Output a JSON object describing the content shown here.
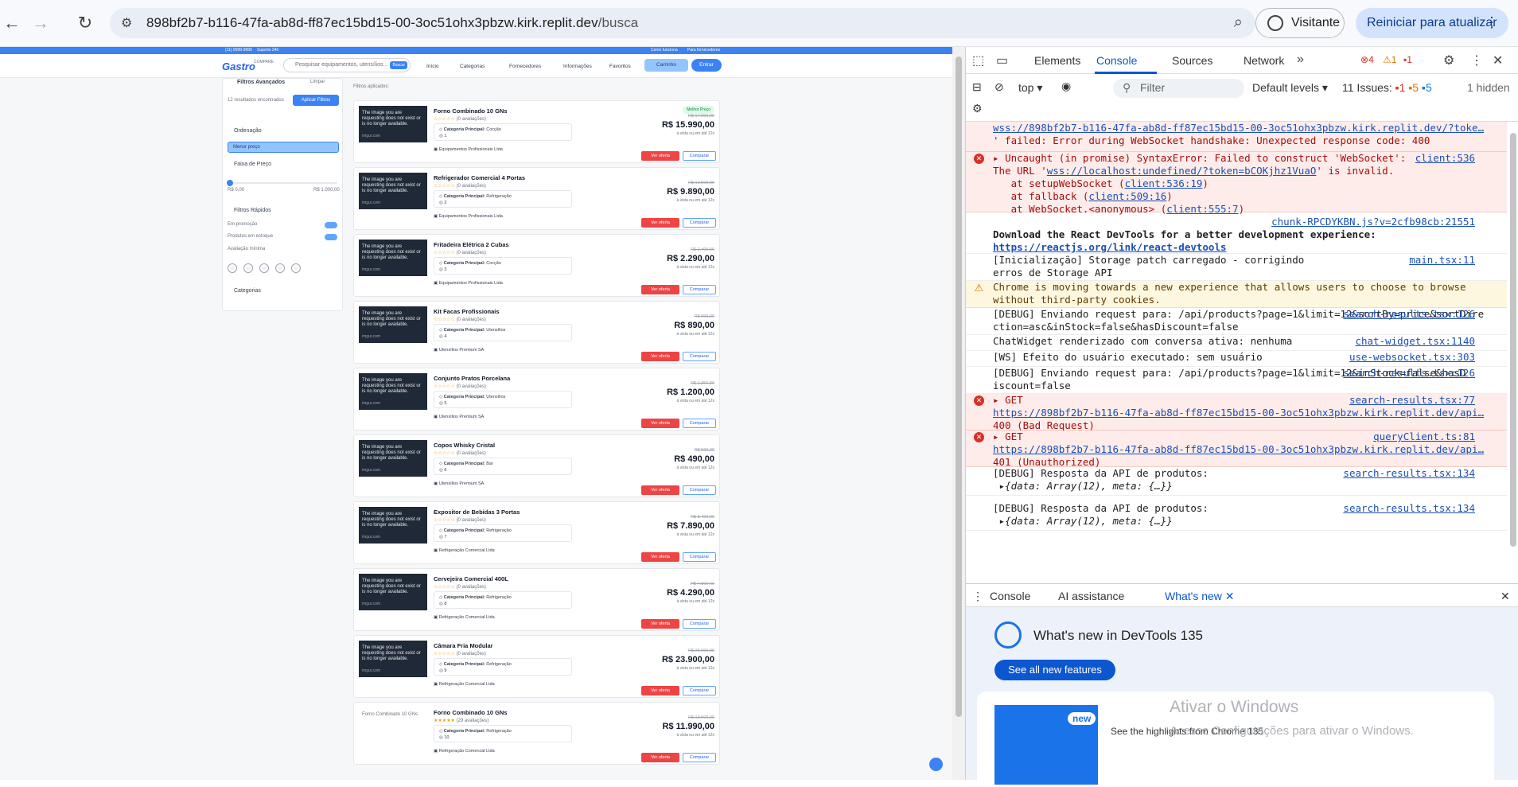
{
  "browser": {
    "url_host": "898bf2b7-b116-47fa-ab8d-ff87ec15bd15-00-3oc51ohx3pbzw.kirk.replit.dev",
    "url_path": "/busca",
    "profile_label": "Visitante",
    "restart_label": "Reiniciar para atualizar"
  },
  "site": {
    "topbar_left": "(11) 9999-9999",
    "topbar_left2": "Suporte 24h",
    "topbar_right": "Como funciona",
    "topbar_right2": "Para fornecedores",
    "logo": "Gastro",
    "logo_sub": "COMPARE",
    "search_placeholder": "Pesquisar equipamentos, utensílios...",
    "search_badge": "Buscar",
    "nav": [
      "Início",
      "Categorias",
      "Fornecedores",
      "Informações",
      "Favoritos"
    ],
    "cart": "Carrinho",
    "enter": "Entrar"
  },
  "filters": {
    "title": "Filtros Avançados",
    "clear": "Limpar",
    "results_count": "12 resultados encontrados",
    "apply": "Aplicar Filtros",
    "ordering": "Ordenação",
    "order_value": "Menor preço",
    "price_range": "Faixa de Preço",
    "price_min": "R$ 0,00",
    "price_max": "R$ 1.000,00",
    "quick": "Filtros Rápidos",
    "promo": "Em promoção",
    "in_stock": "Produtos em estoque",
    "min_rating": "Avaliação mínima",
    "categories": "Categorias"
  },
  "results_label": "Filtros aplicados:",
  "thumb_text": "The image you are requesting does not exist or is no longer available.",
  "thumb_credit": "imgur.com",
  "offer_label": "Ver oferta",
  "compare_label": "Comparar",
  "installments": "à vista ou em até 12x",
  "category_prefix": "Categoria Principal:",
  "products": [
    {
      "name": "Forno Combinado 10 GNs",
      "reviews": "(0 avaliações)",
      "category": "Cocção",
      "old": "R$ 17.990,00",
      "price": "R$ 15.990,00",
      "vendor": "Equipamentos Profissionais Ltda",
      "badge": "Melhor Preço",
      "count": "1"
    },
    {
      "name": "Refrigerador Comercial 4 Portas",
      "reviews": "(0 avaliações)",
      "category": "Refrigeração",
      "old": "R$ 10.500,00",
      "price": "R$ 9.890,00",
      "vendor": "Equipamentos Profissionais Ltda",
      "count": "2"
    },
    {
      "name": "Fritadeira Elétrica 2 Cubas",
      "reviews": "(0 avaliações)",
      "category": "Cocção",
      "old": "R$ 2.490,00",
      "price": "R$ 2.290,00",
      "vendor": "Equipamentos Profissionais Ltda",
      "count": "3"
    },
    {
      "name": "Kit Facas Profissionais",
      "reviews": "(0 avaliações)",
      "category": "Utensílios",
      "old": "R$ 990,00",
      "price": "R$ 890,00",
      "vendor": "Utensílios Premium SA",
      "count": "4"
    },
    {
      "name": "Conjunto Pratos Porcelana",
      "reviews": "(0 avaliações)",
      "category": "Utensílios",
      "old": "R$ 1.350,00",
      "price": "R$ 1.200,00",
      "vendor": "Utensílios Premium SA",
      "count": "5"
    },
    {
      "name": "Copos Whisky Cristal",
      "reviews": "(0 avaliações)",
      "category": "Bar",
      "old": "R$ 590,00",
      "price": "R$ 490,00",
      "vendor": "Utensílios Premium SA",
      "count": "6"
    },
    {
      "name": "Expositor de Bebidas 3 Portas",
      "reviews": "(0 avaliações)",
      "category": "Refrigeração",
      "old": "R$ 8.490,00",
      "price": "R$ 7.890,00",
      "vendor": "Refrigeração Comercial Ltda",
      "count": "7"
    },
    {
      "name": "Cervejeira Comercial 400L",
      "reviews": "(0 avaliações)",
      "category": "Refrigeração",
      "old": "R$ 4.890,00",
      "price": "R$ 4.290,00",
      "vendor": "Refrigeração Comercial Ltda",
      "count": "8"
    },
    {
      "name": "Câmara Fria Modular",
      "reviews": "(0 avaliações)",
      "category": "Refrigeração",
      "old": "R$ 25.900,00",
      "price": "R$ 23.900,00",
      "vendor": "Refrigeração Comercial Ltda",
      "count": "9"
    },
    {
      "name": "Forno Combinado 10 GNs",
      "reviews": "(29 avaliações)",
      "category": "Refrigeração",
      "old": "R$ 13.500,00",
      "price": "R$ 11.990,00",
      "vendor": "Refrigeração Comercial Ltda",
      "placeholder": "Forno Combinado 10 GNs",
      "count": "10"
    }
  ],
  "devtools": {
    "tabs": [
      "Elements",
      "Console",
      "Sources",
      "Network"
    ],
    "errors": "4",
    "warnings": "1",
    "issues_badge": "1",
    "context": "top",
    "filter_placeholder": "Filter",
    "levels": "Default levels",
    "issues_label": "11 Issues:",
    "issues_e": "1",
    "issues_w": "5",
    "issues_i": "5",
    "hidden": "1 hidden",
    "drawer_tabs": [
      "Console",
      "AI assistance",
      "What's new"
    ],
    "whats_new_title": "What's new in DevTools 135",
    "see_all": "See all new features",
    "new_tag": "new",
    "highlights": "See the highlights from Chrome 135"
  },
  "console": {
    "m1_link": "wss://898bf2b7-b116-47fa-ab8d-ff87ec15bd15-00-3oc51ohx3pbzw.kirk.replit.dev/?toke…",
    "m1_text": "' failed: Error during WebSocket handshake: Unexpected response code: 400",
    "m2_text": "Uncaught (in promise) SyntaxError: Failed to construct 'WebSocket':",
    "m2_src": "client:536",
    "m2_l2a": "The URL '",
    "m2_l2link": "wss://localhost:undefined/?token=bCOKjhz1VuaO",
    "m2_l2b": "' is invalid.",
    "m2_s1": "at setupWebSocket (",
    "m2_s1l": "client:536:19",
    "m2_s2": "at fallback (",
    "m2_s2l": "client:509:16",
    "m2_s3": "at WebSocket.<anonymous> (",
    "m2_s3l": "client:555:7",
    "m3_src": "chunk-RPCDYKBN.js?v=2cfb98cb:21551",
    "m3_text": "Download the React DevTools for a better development experience:",
    "m3_link": "https://reactjs.org/link/react-devtools",
    "m4_text": "[Inicialização] Storage patch carregado - corrigindo erros de Storage API",
    "m4_src": "main.tsx:11",
    "m5_text": "Chrome is moving towards a new experience that allows users to choose to browse without third-party cookies.",
    "m6_text": "[DEBUG] Enviando request para: /api/products?page=1&limit=12&sortBy=price&sortDirection=asc&inStock=false&hasDiscount=false",
    "m6_src": "search-results.tsx:126",
    "m7_text": "ChatWidget renderizado com conversa ativa: nenhuma",
    "m7_src": "chat-widget.tsx:1140",
    "m8_text": "[WS] Efeito do usuário executado: sem usuário",
    "m8_src": "use-websocket.tsx:303",
    "m9_text": "[DEBUG] Enviando request para: /api/products?page=1&limit=12&inStock=false&hasDiscount=false",
    "m9_src": "search-results.tsx:126",
    "m10_text": "GET",
    "m10_src": "search-results.tsx:77",
    "m10_link": "https://898bf2b7-b116-47fa-ab8d-ff87ec15bd15-00-3oc51ohx3pbzw.kirk.replit.dev/api…",
    "m10_status": "400 (Bad Request)",
    "m11_text": "GET",
    "m11_src": "queryClient.ts:81",
    "m11_link": "https://898bf2b7-b116-47fa-ab8d-ff87ec15bd15-00-3oc51ohx3pbzw.kirk.replit.dev/api…",
    "m11_status": "401 (Unauthorized)",
    "m12_text": "[DEBUG] Resposta da API de produtos:",
    "m12_src": "search-results.tsx:134",
    "m12_obj": "{data: Array(12), meta: {…}}",
    "m13_text": "[DEBUG] Resposta da API de produtos:",
    "m13_src": "search-results.tsx:134",
    "m13_obj": "{data: Array(12), meta: {…}}"
  },
  "watermark": {
    "line1": "Ativar o Windows",
    "line2": "Acesse Configurações para ativar o Windows."
  }
}
